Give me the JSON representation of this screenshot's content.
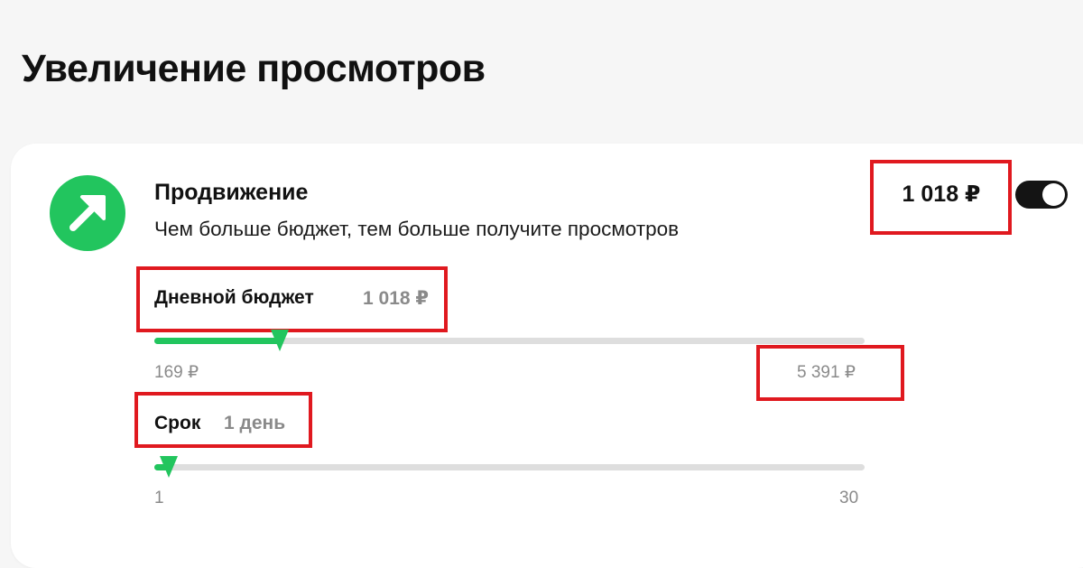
{
  "page": {
    "title": "Увеличение просмотров"
  },
  "promo": {
    "icon": "arrow-up-right-icon",
    "title": "Продвижение",
    "description": "Чем больше бюджет, тем больше получите просмотров",
    "price": "1 018 ₽",
    "toggle_on": true
  },
  "budget": {
    "label": "Дневной бюджет",
    "value": "1 018 ₽",
    "min_label": "169 ₽",
    "max_label": "5 391 ₽",
    "level": 0.163
  },
  "duration": {
    "label": "Срок",
    "value": "1 день",
    "min_label": "1",
    "max_label": "30",
    "level": 0.0
  },
  "colors": {
    "accent": "#22c55e",
    "highlight": "#e0191f",
    "toggle": "#141414"
  }
}
